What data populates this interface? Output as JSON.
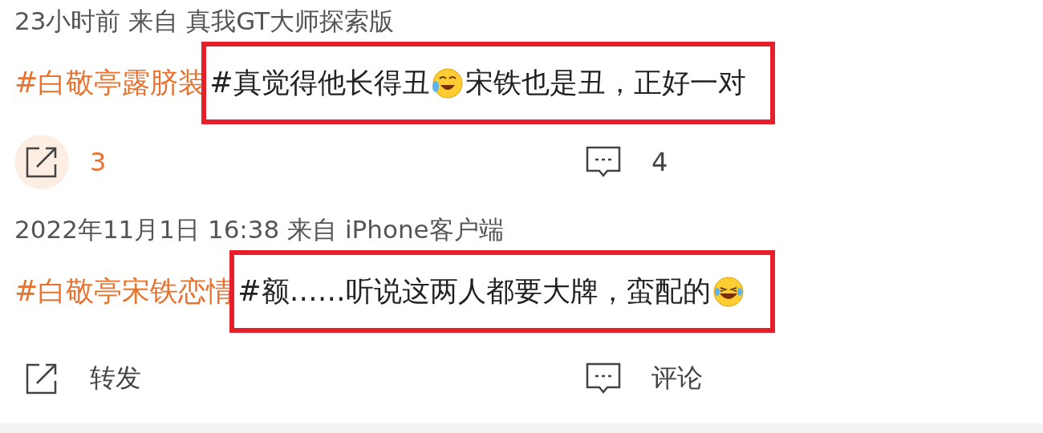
{
  "posts": [
    {
      "meta": "23小时前  来自  真我GT大师探索版",
      "tag": "#白敬亭露脐装",
      "segments": [
        {
          "kind": "text",
          "text": "#真觉得他长得丑"
        },
        {
          "kind": "tearjoy"
        },
        {
          "kind": "text",
          "text": "宋铁也是丑，正好一对"
        }
      ],
      "actions": [
        {
          "kind": "repost",
          "label": "3",
          "pressed": true
        },
        {
          "kind": "comment",
          "label": "4",
          "pressed": false
        }
      ]
    },
    {
      "meta": "2022年11月1日 16:38  来自  iPhone客户端",
      "tag": "#白敬亭宋铁恋情",
      "segments": [
        {
          "kind": "text",
          "text": "#额……听说这两人都要大牌，蛮配的"
        },
        {
          "kind": "grin"
        }
      ],
      "actions": [
        {
          "kind": "repost",
          "label": "转发",
          "pressed": false
        },
        {
          "kind": "comment",
          "label": "评论",
          "pressed": false
        }
      ]
    }
  ]
}
